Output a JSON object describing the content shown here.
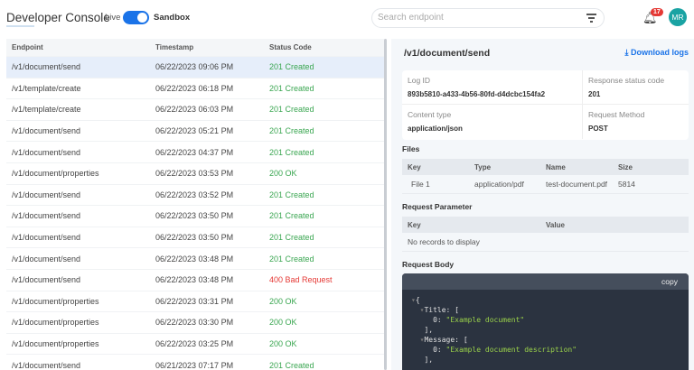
{
  "header": {
    "title": "Developer Console",
    "live_label": "Live",
    "sandbox_label": "Sandbox",
    "search_placeholder": "Search endpoint",
    "notification_count": "17",
    "avatar_initials": "MR"
  },
  "log_table": {
    "columns": [
      "Endpoint",
      "Timestamp",
      "Status Code"
    ],
    "rows": [
      [
        "/v1/document/send",
        "06/22/2023 09:06 PM",
        "201 Created"
      ],
      [
        "/v1/template/create",
        "06/22/2023 06:18 PM",
        "201 Created"
      ],
      [
        "/v1/template/create",
        "06/22/2023 06:03 PM",
        "201 Created"
      ],
      [
        "/v1/document/send",
        "06/22/2023 05:21 PM",
        "201 Created"
      ],
      [
        "/v1/document/send",
        "06/22/2023 04:37 PM",
        "201 Created"
      ],
      [
        "/v1/document/properties",
        "06/22/2023 03:53 PM",
        "200 OK"
      ],
      [
        "/v1/document/send",
        "06/22/2023 03:52 PM",
        "201 Created"
      ],
      [
        "/v1/document/send",
        "06/22/2023 03:50 PM",
        "201 Created"
      ],
      [
        "/v1/document/send",
        "06/22/2023 03:50 PM",
        "201 Created"
      ],
      [
        "/v1/document/send",
        "06/22/2023 03:48 PM",
        "201 Created"
      ],
      [
        "/v1/document/send",
        "06/22/2023 03:48 PM",
        "400 Bad Request"
      ],
      [
        "/v1/document/properties",
        "06/22/2023 03:31 PM",
        "200 OK"
      ],
      [
        "/v1/document/properties",
        "06/22/2023 03:30 PM",
        "200 OK"
      ],
      [
        "/v1/document/properties",
        "06/22/2023 03:25 PM",
        "200 OK"
      ],
      [
        "/v1/document/send",
        "06/21/2023 07:17 PM",
        "201 Created"
      ]
    ]
  },
  "detail": {
    "path": "/v1/document/send",
    "download_label": "Download logs",
    "log_id_label": "Log ID",
    "log_id": "893b5810-a433-4b56-80fd-d4dcbc154fa2",
    "status_label": "Response status code",
    "status": "201",
    "content_type_label": "Content type",
    "content_type": "application/json",
    "method_label": "Request Method",
    "method": "POST",
    "files_title": "Files",
    "files_columns": [
      "Key",
      "Type",
      "Name",
      "Size"
    ],
    "files_rows": [
      [
        "File 1",
        "application/pdf",
        "test-document.pdf",
        "5814"
      ]
    ],
    "params_title": "Request Parameter",
    "params_columns": [
      "Key",
      "Value"
    ],
    "params_empty": "No records to display",
    "body_title": "Request Body",
    "copy_label": "copy",
    "body_lines": [
      "{",
      "Title: [",
      "0: ",
      "\"Example document\"",
      "],",
      "Message: [",
      "0: ",
      "\"Example document description\"",
      "],"
    ]
  },
  "colors": {
    "accent": "#1a73e8",
    "success": "#3aa651",
    "error": "#e53935"
  }
}
